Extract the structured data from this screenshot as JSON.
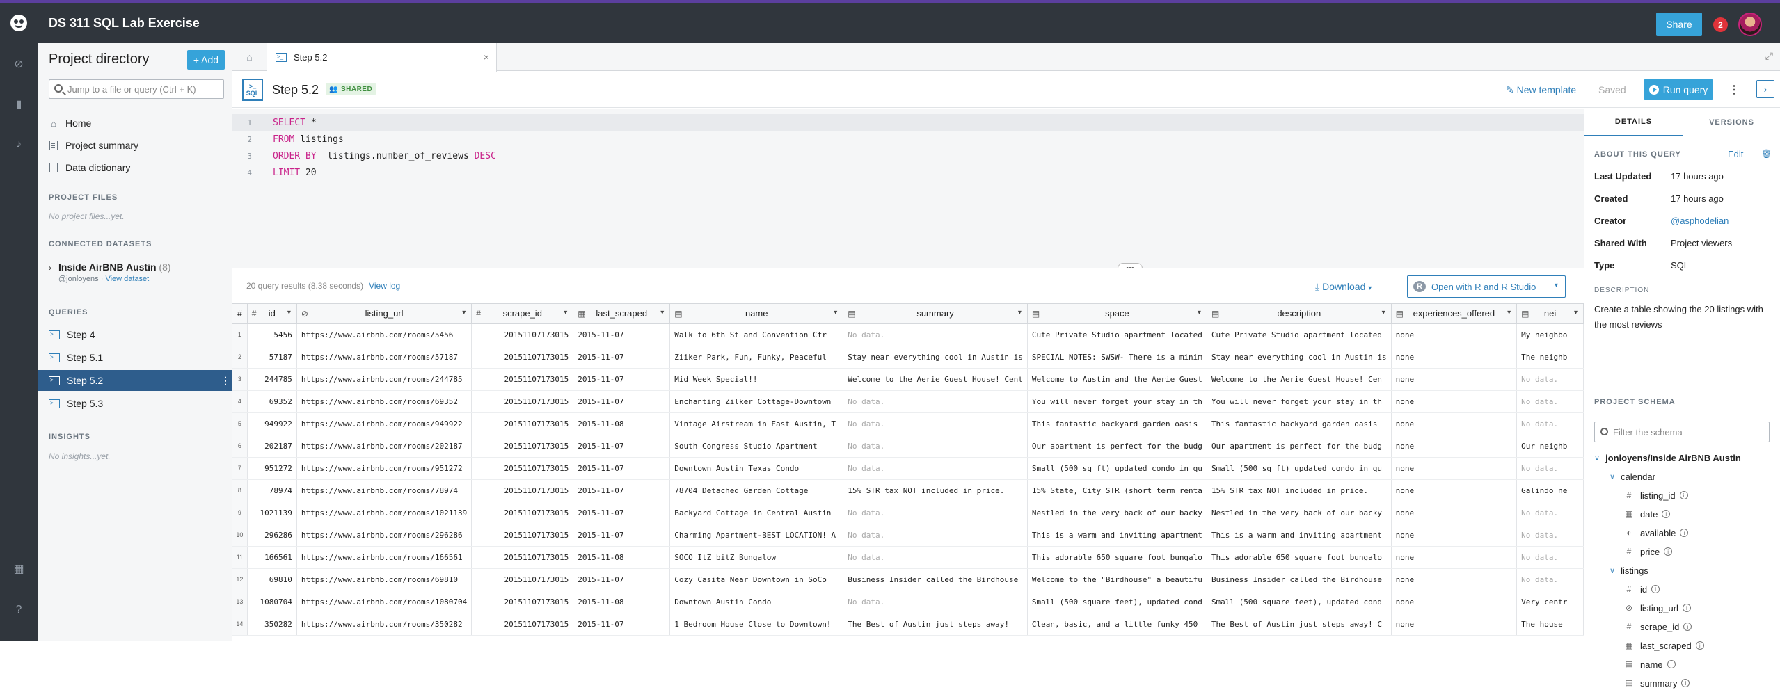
{
  "app": {
    "title": "DS 311 SQL Lab Exercise",
    "share_label": "Share",
    "notifications": "2"
  },
  "sidebar": {
    "title": "Project directory",
    "add_label": "+ Add",
    "jump_placeholder": "Jump to a file or query (Ctrl + K)",
    "nav": [
      {
        "label": "Home",
        "icon": "home-icon"
      },
      {
        "label": "Project summary",
        "icon": "document-icon"
      },
      {
        "label": "Data dictionary",
        "icon": "document-icon"
      }
    ],
    "project_files_head": "PROJECT FILES",
    "project_files_empty": "No project files...yet.",
    "datasets_head": "CONNECTED DATASETS",
    "dataset": {
      "name": "Inside AirBNB Austin",
      "count": "(8)",
      "owner": "@jonloyens",
      "sep": "·",
      "view": "View dataset"
    },
    "queries_head": "QUERIES",
    "queries": [
      "Step 4",
      "Step 5.1",
      "Step 5.2",
      "Step 5.3"
    ],
    "insights_head": "INSIGHTS",
    "insights_empty": "No insights...yet."
  },
  "tab": {
    "label": "Step 5.2"
  },
  "query": {
    "title": "Step 5.2",
    "badge": "SHARED",
    "badge_icon": "people-icon",
    "new_template": "New template",
    "saved": "Saved",
    "run": "Run query",
    "sql_icon_label": "SQL"
  },
  "editor": {
    "lines": [
      {
        "n": "1",
        "kw": "SELECT",
        "rest": " *"
      },
      {
        "n": "2",
        "kw": "FROM",
        "rest": " listings"
      },
      {
        "n": "3",
        "kw": "ORDER BY",
        "rest": "  listings.number_of_reviews ",
        "kw2": "DESC"
      },
      {
        "n": "4",
        "kw": "LIMIT",
        "rest": " 20"
      }
    ]
  },
  "results": {
    "summary": "20 query results (8.38 seconds)",
    "view_log": "View log",
    "download": "Download",
    "open_r": "Open with R and R Studio",
    "columns": [
      {
        "name": "#",
        "icon": ""
      },
      {
        "name": "id",
        "icon": "#"
      },
      {
        "name": "listing_url",
        "icon": "link"
      },
      {
        "name": "scrape_id",
        "icon": "#"
      },
      {
        "name": "last_scraped",
        "icon": "cal"
      },
      {
        "name": "name",
        "icon": "txt"
      },
      {
        "name": "summary",
        "icon": "txt"
      },
      {
        "name": "space",
        "icon": "txt"
      },
      {
        "name": "description",
        "icon": "txt"
      },
      {
        "name": "experiences_offered",
        "icon": "txt"
      },
      {
        "name": "nei",
        "icon": "txt"
      }
    ],
    "rows": [
      [
        "1",
        "5456",
        "https://www.airbnb.com/rooms/5456",
        "20151107173015",
        "2015-11-07",
        "Walk to 6th St and Convention Ctr",
        "No data.",
        "Cute Private Studio apartment located",
        "Cute Private Studio apartment located",
        "none",
        "My neighbo"
      ],
      [
        "2",
        "57187",
        "https://www.airbnb.com/rooms/57187",
        "20151107173015",
        "2015-11-07",
        "Ziiker Park, Fun, Funky, Peaceful",
        "Stay near everything cool in Austin is",
        "SPECIAL NOTES: SWSW-  There is a minim",
        "Stay near everything cool in Austin is",
        "none",
        "The neighb"
      ],
      [
        "3",
        "244785",
        "https://www.airbnb.com/rooms/244785",
        "20151107173015",
        "2015-11-07",
        "Mid Week Special!!",
        "Welcome to the Aerie Guest House! Cent",
        "Welcome to Austin and the Aerie Guest",
        "Welcome to the Aerie Guest House! Cen",
        "none",
        "No data."
      ],
      [
        "4",
        "69352",
        "https://www.airbnb.com/rooms/69352",
        "20151107173015",
        "2015-11-07",
        "Enchanting Zilker Cottage-Downtown",
        "No data.",
        "You will never forget your stay in th",
        "You will never forget your stay in th",
        "none",
        "No data."
      ],
      [
        "5",
        "949922",
        "https://www.airbnb.com/rooms/949922",
        "20151107173015",
        "2015-11-08",
        "Vintage Airstream in East Austin, T",
        "No data.",
        "This fantastic backyard garden oasis",
        "This fantastic backyard garden oasis",
        "none",
        "No data."
      ],
      [
        "6",
        "202187",
        "https://www.airbnb.com/rooms/202187",
        "20151107173015",
        "2015-11-07",
        "South Congress Studio Apartment",
        "No data.",
        "Our apartment is perfect for the budg",
        "Our apartment is perfect for the budg",
        "none",
        "Our neighb"
      ],
      [
        "7",
        "951272",
        "https://www.airbnb.com/rooms/951272",
        "20151107173015",
        "2015-11-07",
        "Downtown Austin Texas Condo",
        "No data.",
        "Small (500 sq ft) updated condo in qu",
        "Small (500 sq ft) updated condo in qu",
        "none",
        "No data."
      ],
      [
        "8",
        "78974",
        "https://www.airbnb.com/rooms/78974",
        "20151107173015",
        "2015-11-07",
        "78704 Detached Garden  Cottage",
        "15% STR tax NOT included in price.",
        "15% State, City STR (short term renta",
        "15% STR tax NOT included in price.",
        "none",
        "Galindo ne"
      ],
      [
        "9",
        "1021139",
        "https://www.airbnb.com/rooms/1021139",
        "20151107173015",
        "2015-11-07",
        "Backyard Cottage in Central Austin",
        "No data.",
        "Nestled in the very back of our backy",
        "Nestled in the very back of our backy",
        "none",
        "No data."
      ],
      [
        "10",
        "296286",
        "https://www.airbnb.com/rooms/296286",
        "20151107173015",
        "2015-11-07",
        "Charming Apartment-BEST LOCATION! A",
        "No data.",
        "This is a warm and inviting apartment",
        "This is a warm and inviting apartment",
        "none",
        "No data."
      ],
      [
        "11",
        "166561",
        "https://www.airbnb.com/rooms/166561",
        "20151107173015",
        "2015-11-08",
        "SOCO ItZ bitZ Bungalow",
        "No data.",
        "This adorable 650 square foot bungalo",
        "This adorable 650 square foot bungalo",
        "none",
        "No data."
      ],
      [
        "12",
        "69810",
        "https://www.airbnb.com/rooms/69810",
        "20151107173015",
        "2015-11-07",
        "Cozy Casita Near Downtown in SoCo",
        "Business Insider called the Birdhouse",
        "Welcome to the \"Birdhouse\" a beautifu",
        "Business Insider called the Birdhouse",
        "none",
        "No data."
      ],
      [
        "13",
        "1080704",
        "https://www.airbnb.com/rooms/1080704",
        "20151107173015",
        "2015-11-08",
        "Downtown Austin Condo",
        "No data.",
        "Small (500 square feet), updated cond",
        "Small (500 square feet), updated cond",
        "none",
        "Very centr"
      ],
      [
        "14",
        "350282",
        "https://www.airbnb.com/rooms/350282",
        "20151107173015",
        "2015-11-07",
        "1 Bedroom House Close to Downtown!",
        "The Best of Austin just steps away!",
        "Clean, basic, and a little funky 450",
        "The Best of Austin just steps away! C",
        "none",
        "The house"
      ]
    ]
  },
  "details": {
    "tab_details": "DETAILS",
    "tab_versions": "VERSIONS",
    "about_head": "ABOUT THIS QUERY",
    "edit": "Edit",
    "fields": [
      {
        "k": "Last Updated",
        "v": "17 hours ago"
      },
      {
        "k": "Created",
        "v": "17 hours ago"
      },
      {
        "k": "Creator",
        "v": "@asphodelian"
      },
      {
        "k": "Shared With",
        "v": "Project viewers"
      },
      {
        "k": "Type",
        "v": "SQL"
      }
    ],
    "desc_head": "DESCRIPTION",
    "description": "Create a table showing the 20 listings with the most reviews",
    "schema_head": "PROJECT SCHEMA",
    "filter_placeholder": "Filter the schema",
    "schema_root": "jonloyens/Inside AirBNB Austin",
    "tables": [
      {
        "name": "calendar",
        "cols": [
          {
            "name": "listing_id",
            "icon": "#"
          },
          {
            "name": "date",
            "icon": "cal"
          },
          {
            "name": "available",
            "icon": "toggle"
          },
          {
            "name": "price",
            "icon": "#"
          }
        ]
      },
      {
        "name": "listings",
        "cols": [
          {
            "name": "id",
            "icon": "#"
          },
          {
            "name": "listing_url",
            "icon": "link"
          },
          {
            "name": "scrape_id",
            "icon": "#"
          },
          {
            "name": "last_scraped",
            "icon": "cal"
          },
          {
            "name": "name",
            "icon": "txt"
          },
          {
            "name": "summary",
            "icon": "txt"
          }
        ]
      }
    ]
  }
}
